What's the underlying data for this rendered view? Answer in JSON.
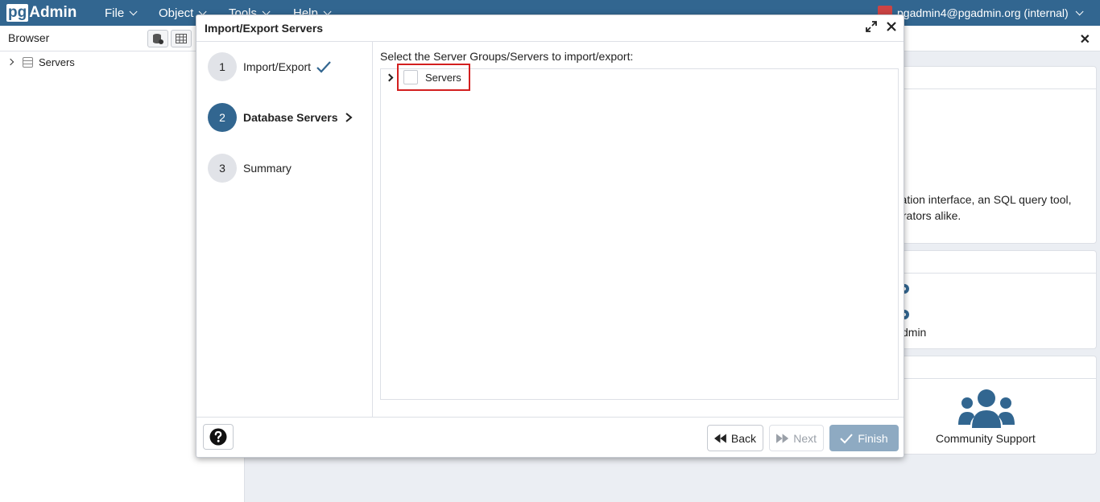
{
  "app": {
    "logo_pg": "pg",
    "logo_admin": "Admin",
    "menus": [
      "File",
      "Object",
      "Tools",
      "Help"
    ],
    "user": "pgadmin4@pgadmin.org (internal)"
  },
  "browser": {
    "title": "Browser",
    "tree": [
      {
        "label": "Servers"
      }
    ]
  },
  "dashboard": {
    "welcome_line1": "tration interface, an SQL query tool,",
    "welcome_line2": "strators alike.",
    "admin_label": "dmin",
    "community_label": "Community Support"
  },
  "modal": {
    "title": "Import/Export Servers",
    "steps": [
      {
        "number": "1",
        "label": "Import/Export",
        "state": "done"
      },
      {
        "number": "2",
        "label": "Database Servers",
        "state": "active"
      },
      {
        "number": "3",
        "label": "Summary",
        "state": "pending"
      }
    ],
    "instruction": "Select the Server Groups/Servers to import/export:",
    "tree_item": {
      "label": "Servers",
      "checked": false
    },
    "buttons": {
      "back": "Back",
      "next": "Next",
      "finish": "Finish"
    }
  },
  "colors": {
    "navbar": "#326690",
    "active_step": "#326690",
    "finish_disabled": "#8eaac2",
    "highlight": "#d31f1f"
  }
}
